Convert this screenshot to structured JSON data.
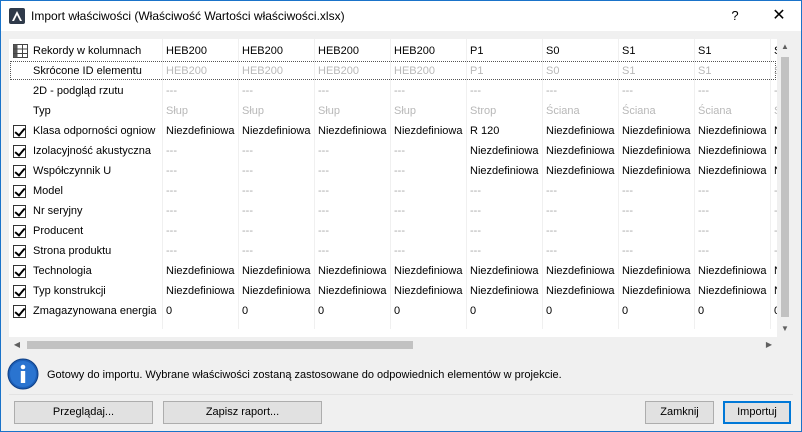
{
  "window": {
    "title": "Import właściwości (Właściwość Wartości właściwości.xlsx)",
    "help_glyph": "?",
    "close_glyph": "✕"
  },
  "grid": {
    "header_label": "Rekordy w kolumnach",
    "columns": [
      "HEB200",
      "HEB200",
      "HEB200",
      "HEB200",
      "P1",
      "S0",
      "S1",
      "S1",
      "S"
    ],
    "rows": [
      {
        "label": "Skrócone ID elementu",
        "checkbox": false,
        "style": "dim",
        "values": [
          "HEB200",
          "HEB200",
          "HEB200",
          "HEB200",
          "P1",
          "S0",
          "S1",
          "S1",
          "S"
        ]
      },
      {
        "label": "2D - podgląd rzutu",
        "checkbox": false,
        "style": "dash",
        "values": [
          "---",
          "---",
          "---",
          "---",
          "---",
          "---",
          "---",
          "---",
          "-"
        ]
      },
      {
        "label": "Typ",
        "checkbox": false,
        "style": "dim",
        "values": [
          "Słup",
          "Słup",
          "Słup",
          "Słup",
          "Strop",
          "Ściana",
          "Ściana",
          "Ściana",
          "Ś"
        ]
      },
      {
        "label": "Klasa odporności ogniow",
        "checkbox": true,
        "style": "normal",
        "values": [
          "Niezdefiniowa",
          "Niezdefiniowa",
          "Niezdefiniowa",
          "Niezdefiniowa",
          "R 120",
          "Niezdefiniowa",
          "Niezdefiniowa",
          "Niezdefiniowa",
          "N"
        ]
      },
      {
        "label": "Izolacyjność akustyczna",
        "checkbox": true,
        "style": "mixed",
        "values": [
          "---",
          "---",
          "---",
          "---",
          "Niezdefiniowa",
          "Niezdefiniowa",
          "Niezdefiniowa",
          "Niezdefiniowa",
          "N"
        ]
      },
      {
        "label": "Współczynnik U",
        "checkbox": true,
        "style": "mixed",
        "values": [
          "---",
          "---",
          "---",
          "---",
          "Niezdefiniowa",
          "Niezdefiniowa",
          "Niezdefiniowa",
          "Niezdefiniowa",
          "N"
        ]
      },
      {
        "label": "Model",
        "checkbox": true,
        "style": "dash",
        "values": [
          "---",
          "---",
          "---",
          "---",
          "---",
          "---",
          "---",
          "---",
          "-"
        ]
      },
      {
        "label": "Nr seryjny",
        "checkbox": true,
        "style": "dash",
        "values": [
          "---",
          "---",
          "---",
          "---",
          "---",
          "---",
          "---",
          "---",
          "-"
        ]
      },
      {
        "label": "Producent",
        "checkbox": true,
        "style": "dash",
        "values": [
          "---",
          "---",
          "---",
          "---",
          "---",
          "---",
          "---",
          "---",
          "-"
        ]
      },
      {
        "label": "Strona produktu",
        "checkbox": true,
        "style": "dash",
        "values": [
          "---",
          "---",
          "---",
          "---",
          "---",
          "---",
          "---",
          "---",
          "-"
        ]
      },
      {
        "label": "Technologia",
        "checkbox": true,
        "style": "normal",
        "values": [
          "Niezdefiniowa",
          "Niezdefiniowa",
          "Niezdefiniowa",
          "Niezdefiniowa",
          "Niezdefiniowa",
          "Niezdefiniowa",
          "Niezdefiniowa",
          "Niezdefiniowa",
          "N"
        ]
      },
      {
        "label": "Typ konstrukcji",
        "checkbox": true,
        "style": "normal",
        "values": [
          "Niezdefiniowa",
          "Niezdefiniowa",
          "Niezdefiniowa",
          "Niezdefiniowa",
          "Niezdefiniowa",
          "Niezdefiniowa",
          "Niezdefiniowa",
          "Niezdefiniowa",
          "N"
        ]
      },
      {
        "label": "Zmagazynowana energia",
        "checkbox": true,
        "style": "normal",
        "values": [
          "0",
          "0",
          "0",
          "0",
          "0",
          "0",
          "0",
          "0",
          "0"
        ]
      }
    ]
  },
  "status": {
    "message": "Gotowy do importu. Wybrane właściwości zostaną zastosowane do odpowiednich elementów w projekcie."
  },
  "buttons": {
    "browse": "Przeglądaj...",
    "save_report": "Zapisz raport...",
    "close": "Zamknij",
    "import": "Importuj"
  }
}
